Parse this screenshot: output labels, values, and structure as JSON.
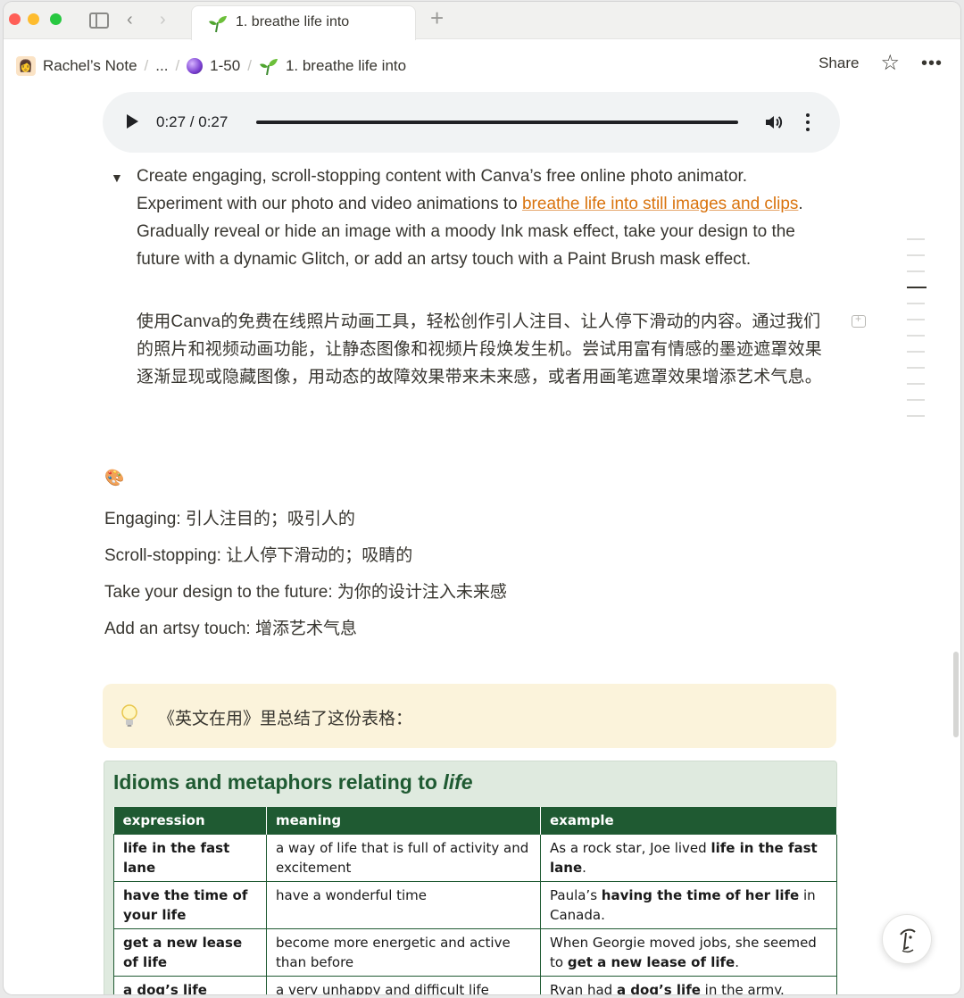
{
  "tabbar": {
    "tab_title": "1. breathe life into"
  },
  "breadcrumb": {
    "workspace": "Rachel’s Note",
    "ellipsis": "...",
    "parent": "1-50",
    "current": "1. breathe life into"
  },
  "header": {
    "share_label": "Share"
  },
  "audio": {
    "time": "0:27 / 0:27"
  },
  "toggle": {
    "en_part1": "Create engaging, scroll-stopping content with Canva’s free online photo animator. Experiment with our photo and video animations to ",
    "en_link": "breathe life into still images and clips",
    "en_part2": ". Gradually reveal or hide an image with a moody Ink mask effect, take your design to the future with a dynamic Glitch, or add an artsy touch with a Paint Brush mask effect.",
    "zh": "使用Canva的免费在线照片动画工具，轻松创作引人注目、让人停下滑动的内容。通过我们的照片和视频动画功能，让静态图像和视频片段焕发生机。尝试用富有情感的墨迹遮罩效果逐渐显现或隐藏图像，用动态的故障效果带来未来感，或者用画笔遮罩效果增添艺术气息。"
  },
  "glossary": [
    "Engaging: 引人注目的；吸引人的",
    "Scroll-stopping: 让人停下滑动的；吸睛的",
    "Take your design to the future: 为你的设计注入未来感",
    "Add an artsy touch: 增添艺术气息"
  ],
  "callout": {
    "text": "《英文在用》里总结了这份表格："
  },
  "idioms": {
    "title_prefix": "Idioms and metaphors relating to ",
    "title_em": "life",
    "headers": [
      "expression",
      "meaning",
      "example"
    ],
    "rows": [
      {
        "expression": "life in the fast lane",
        "meaning": "a way of life that is full of activity and excitement",
        "ex_a": "As a rock star, Joe lived ",
        "ex_b": "life in the fast lane",
        "ex_c": "."
      },
      {
        "expression": "have the time of your life",
        "meaning": "have a wonderful time",
        "ex_a": "Paula’s ",
        "ex_b": "having the time of her life",
        "ex_c": " in Canada."
      },
      {
        "expression": "get a new lease of life",
        "meaning": "become more energetic and active than before",
        "ex_a": "When Georgie moved jobs, she seemed to ",
        "ex_b": "get a new lease of life",
        "ex_c": "."
      },
      {
        "expression": "a dog’s life",
        "meaning": "a very unhappy and difficult life",
        "ex_a": "Ryan had ",
        "ex_b": "a dog’s life",
        "ex_c": " in the army."
      }
    ]
  },
  "colors": {
    "link": "#d9730d",
    "callout_bg": "#fbf3db",
    "table_green": "#1f5a32"
  }
}
